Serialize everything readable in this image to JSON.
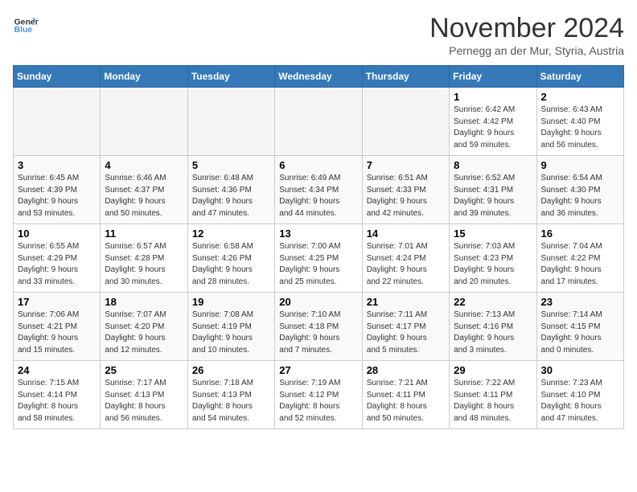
{
  "logo": {
    "line1": "General",
    "line2": "Blue"
  },
  "title": "November 2024",
  "subtitle": "Pernegg an der Mur, Styria, Austria",
  "days_of_week": [
    "Sunday",
    "Monday",
    "Tuesday",
    "Wednesday",
    "Thursday",
    "Friday",
    "Saturday"
  ],
  "weeks": [
    [
      {
        "day": "",
        "info": ""
      },
      {
        "day": "",
        "info": ""
      },
      {
        "day": "",
        "info": ""
      },
      {
        "day": "",
        "info": ""
      },
      {
        "day": "",
        "info": ""
      },
      {
        "day": "1",
        "info": "Sunrise: 6:42 AM\nSunset: 4:42 PM\nDaylight: 9 hours\nand 59 minutes."
      },
      {
        "day": "2",
        "info": "Sunrise: 6:43 AM\nSunset: 4:40 PM\nDaylight: 9 hours\nand 56 minutes."
      }
    ],
    [
      {
        "day": "3",
        "info": "Sunrise: 6:45 AM\nSunset: 4:39 PM\nDaylight: 9 hours\nand 53 minutes."
      },
      {
        "day": "4",
        "info": "Sunrise: 6:46 AM\nSunset: 4:37 PM\nDaylight: 9 hours\nand 50 minutes."
      },
      {
        "day": "5",
        "info": "Sunrise: 6:48 AM\nSunset: 4:36 PM\nDaylight: 9 hours\nand 47 minutes."
      },
      {
        "day": "6",
        "info": "Sunrise: 6:49 AM\nSunset: 4:34 PM\nDaylight: 9 hours\nand 44 minutes."
      },
      {
        "day": "7",
        "info": "Sunrise: 6:51 AM\nSunset: 4:33 PM\nDaylight: 9 hours\nand 42 minutes."
      },
      {
        "day": "8",
        "info": "Sunrise: 6:52 AM\nSunset: 4:31 PM\nDaylight: 9 hours\nand 39 minutes."
      },
      {
        "day": "9",
        "info": "Sunrise: 6:54 AM\nSunset: 4:30 PM\nDaylight: 9 hours\nand 36 minutes."
      }
    ],
    [
      {
        "day": "10",
        "info": "Sunrise: 6:55 AM\nSunset: 4:29 PM\nDaylight: 9 hours\nand 33 minutes."
      },
      {
        "day": "11",
        "info": "Sunrise: 6:57 AM\nSunset: 4:28 PM\nDaylight: 9 hours\nand 30 minutes."
      },
      {
        "day": "12",
        "info": "Sunrise: 6:58 AM\nSunset: 4:26 PM\nDaylight: 9 hours\nand 28 minutes."
      },
      {
        "day": "13",
        "info": "Sunrise: 7:00 AM\nSunset: 4:25 PM\nDaylight: 9 hours\nand 25 minutes."
      },
      {
        "day": "14",
        "info": "Sunrise: 7:01 AM\nSunset: 4:24 PM\nDaylight: 9 hours\nand 22 minutes."
      },
      {
        "day": "15",
        "info": "Sunrise: 7:03 AM\nSunset: 4:23 PM\nDaylight: 9 hours\nand 20 minutes."
      },
      {
        "day": "16",
        "info": "Sunrise: 7:04 AM\nSunset: 4:22 PM\nDaylight: 9 hours\nand 17 minutes."
      }
    ],
    [
      {
        "day": "17",
        "info": "Sunrise: 7:06 AM\nSunset: 4:21 PM\nDaylight: 9 hours\nand 15 minutes."
      },
      {
        "day": "18",
        "info": "Sunrise: 7:07 AM\nSunset: 4:20 PM\nDaylight: 9 hours\nand 12 minutes."
      },
      {
        "day": "19",
        "info": "Sunrise: 7:08 AM\nSunset: 4:19 PM\nDaylight: 9 hours\nand 10 minutes."
      },
      {
        "day": "20",
        "info": "Sunrise: 7:10 AM\nSunset: 4:18 PM\nDaylight: 9 hours\nand 7 minutes."
      },
      {
        "day": "21",
        "info": "Sunrise: 7:11 AM\nSunset: 4:17 PM\nDaylight: 9 hours\nand 5 minutes."
      },
      {
        "day": "22",
        "info": "Sunrise: 7:13 AM\nSunset: 4:16 PM\nDaylight: 9 hours\nand 3 minutes."
      },
      {
        "day": "23",
        "info": "Sunrise: 7:14 AM\nSunset: 4:15 PM\nDaylight: 9 hours\nand 0 minutes."
      }
    ],
    [
      {
        "day": "24",
        "info": "Sunrise: 7:15 AM\nSunset: 4:14 PM\nDaylight: 8 hours\nand 58 minutes."
      },
      {
        "day": "25",
        "info": "Sunrise: 7:17 AM\nSunset: 4:13 PM\nDaylight: 8 hours\nand 56 minutes."
      },
      {
        "day": "26",
        "info": "Sunrise: 7:18 AM\nSunset: 4:13 PM\nDaylight: 8 hours\nand 54 minutes."
      },
      {
        "day": "27",
        "info": "Sunrise: 7:19 AM\nSunset: 4:12 PM\nDaylight: 8 hours\nand 52 minutes."
      },
      {
        "day": "28",
        "info": "Sunrise: 7:21 AM\nSunset: 4:11 PM\nDaylight: 8 hours\nand 50 minutes."
      },
      {
        "day": "29",
        "info": "Sunrise: 7:22 AM\nSunset: 4:11 PM\nDaylight: 8 hours\nand 48 minutes."
      },
      {
        "day": "30",
        "info": "Sunrise: 7:23 AM\nSunset: 4:10 PM\nDaylight: 8 hours\nand 47 minutes."
      }
    ]
  ]
}
